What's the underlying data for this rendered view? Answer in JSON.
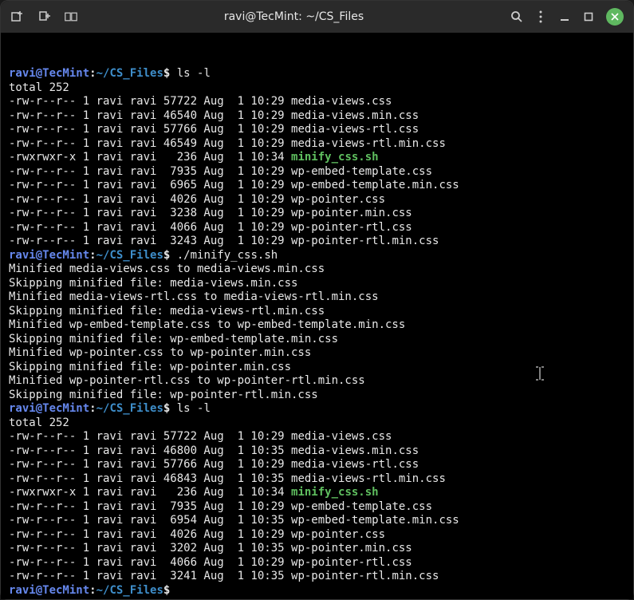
{
  "titlebar": {
    "title": "ravi@TecMint: ~/CS_Files"
  },
  "prompt": {
    "user": "ravi@TecMint",
    "colon": ":",
    "path": "~/CS_Files",
    "dollar": "$"
  },
  "cmd1": "ls -l",
  "total1": "total 252",
  "ls1": [
    {
      "perm": "-rw-r--r--",
      "links": "1",
      "owner": "ravi",
      "group": "ravi",
      "size": "57722",
      "mon": "Aug",
      "day": " 1",
      "time": "10:29",
      "name": "media-views.css",
      "exec": false
    },
    {
      "perm": "-rw-r--r--",
      "links": "1",
      "owner": "ravi",
      "group": "ravi",
      "size": "46540",
      "mon": "Aug",
      "day": " 1",
      "time": "10:29",
      "name": "media-views.min.css",
      "exec": false
    },
    {
      "perm": "-rw-r--r--",
      "links": "1",
      "owner": "ravi",
      "group": "ravi",
      "size": "57766",
      "mon": "Aug",
      "day": " 1",
      "time": "10:29",
      "name": "media-views-rtl.css",
      "exec": false
    },
    {
      "perm": "-rw-r--r--",
      "links": "1",
      "owner": "ravi",
      "group": "ravi",
      "size": "46549",
      "mon": "Aug",
      "day": " 1",
      "time": "10:29",
      "name": "media-views-rtl.min.css",
      "exec": false
    },
    {
      "perm": "-rwxrwxr-x",
      "links": "1",
      "owner": "ravi",
      "group": "ravi",
      "size": "  236",
      "mon": "Aug",
      "day": " 1",
      "time": "10:34",
      "name": "minify_css.sh",
      "exec": true
    },
    {
      "perm": "-rw-r--r--",
      "links": "1",
      "owner": "ravi",
      "group": "ravi",
      "size": " 7935",
      "mon": "Aug",
      "day": " 1",
      "time": "10:29",
      "name": "wp-embed-template.css",
      "exec": false
    },
    {
      "perm": "-rw-r--r--",
      "links": "1",
      "owner": "ravi",
      "group": "ravi",
      "size": " 6965",
      "mon": "Aug",
      "day": " 1",
      "time": "10:29",
      "name": "wp-embed-template.min.css",
      "exec": false
    },
    {
      "perm": "-rw-r--r--",
      "links": "1",
      "owner": "ravi",
      "group": "ravi",
      "size": " 4026",
      "mon": "Aug",
      "day": " 1",
      "time": "10:29",
      "name": "wp-pointer.css",
      "exec": false
    },
    {
      "perm": "-rw-r--r--",
      "links": "1",
      "owner": "ravi",
      "group": "ravi",
      "size": " 3238",
      "mon": "Aug",
      "day": " 1",
      "time": "10:29",
      "name": "wp-pointer.min.css",
      "exec": false
    },
    {
      "perm": "-rw-r--r--",
      "links": "1",
      "owner": "ravi",
      "group": "ravi",
      "size": " 4066",
      "mon": "Aug",
      "day": " 1",
      "time": "10:29",
      "name": "wp-pointer-rtl.css",
      "exec": false
    },
    {
      "perm": "-rw-r--r--",
      "links": "1",
      "owner": "ravi",
      "group": "ravi",
      "size": " 3243",
      "mon": "Aug",
      "day": " 1",
      "time": "10:29",
      "name": "wp-pointer-rtl.min.css",
      "exec": false
    }
  ],
  "cmd2": "./minify_css.sh",
  "script_output": [
    "Minified media-views.css to media-views.min.css",
    "Skipping minified file: media-views.min.css",
    "Minified media-views-rtl.css to media-views-rtl.min.css",
    "Skipping minified file: media-views-rtl.min.css",
    "Minified wp-embed-template.css to wp-embed-template.min.css",
    "Skipping minified file: wp-embed-template.min.css",
    "Minified wp-pointer.css to wp-pointer.min.css",
    "Skipping minified file: wp-pointer.min.css",
    "Minified wp-pointer-rtl.css to wp-pointer-rtl.min.css",
    "Skipping minified file: wp-pointer-rtl.min.css"
  ],
  "cmd3": "ls -l",
  "total2": "total 252",
  "ls2": [
    {
      "perm": "-rw-r--r--",
      "links": "1",
      "owner": "ravi",
      "group": "ravi",
      "size": "57722",
      "mon": "Aug",
      "day": " 1",
      "time": "10:29",
      "name": "media-views.css",
      "exec": false
    },
    {
      "perm": "-rw-r--r--",
      "links": "1",
      "owner": "ravi",
      "group": "ravi",
      "size": "46800",
      "mon": "Aug",
      "day": " 1",
      "time": "10:35",
      "name": "media-views.min.css",
      "exec": false
    },
    {
      "perm": "-rw-r--r--",
      "links": "1",
      "owner": "ravi",
      "group": "ravi",
      "size": "57766",
      "mon": "Aug",
      "day": " 1",
      "time": "10:29",
      "name": "media-views-rtl.css",
      "exec": false
    },
    {
      "perm": "-rw-r--r--",
      "links": "1",
      "owner": "ravi",
      "group": "ravi",
      "size": "46843",
      "mon": "Aug",
      "day": " 1",
      "time": "10:35",
      "name": "media-views-rtl.min.css",
      "exec": false
    },
    {
      "perm": "-rwxrwxr-x",
      "links": "1",
      "owner": "ravi",
      "group": "ravi",
      "size": "  236",
      "mon": "Aug",
      "day": " 1",
      "time": "10:34",
      "name": "minify_css.sh",
      "exec": true
    },
    {
      "perm": "-rw-r--r--",
      "links": "1",
      "owner": "ravi",
      "group": "ravi",
      "size": " 7935",
      "mon": "Aug",
      "day": " 1",
      "time": "10:29",
      "name": "wp-embed-template.css",
      "exec": false
    },
    {
      "perm": "-rw-r--r--",
      "links": "1",
      "owner": "ravi",
      "group": "ravi",
      "size": " 6954",
      "mon": "Aug",
      "day": " 1",
      "time": "10:35",
      "name": "wp-embed-template.min.css",
      "exec": false
    },
    {
      "perm": "-rw-r--r--",
      "links": "1",
      "owner": "ravi",
      "group": "ravi",
      "size": " 4026",
      "mon": "Aug",
      "day": " 1",
      "time": "10:29",
      "name": "wp-pointer.css",
      "exec": false
    },
    {
      "perm": "-rw-r--r--",
      "links": "1",
      "owner": "ravi",
      "group": "ravi",
      "size": " 3202",
      "mon": "Aug",
      "day": " 1",
      "time": "10:35",
      "name": "wp-pointer.min.css",
      "exec": false
    },
    {
      "perm": "-rw-r--r--",
      "links": "1",
      "owner": "ravi",
      "group": "ravi",
      "size": " 4066",
      "mon": "Aug",
      "day": " 1",
      "time": "10:29",
      "name": "wp-pointer-rtl.css",
      "exec": false
    },
    {
      "perm": "-rw-r--r--",
      "links": "1",
      "owner": "ravi",
      "group": "ravi",
      "size": " 3241",
      "mon": "Aug",
      "day": " 1",
      "time": "10:35",
      "name": "wp-pointer-rtl.min.css",
      "exec": false
    }
  ]
}
